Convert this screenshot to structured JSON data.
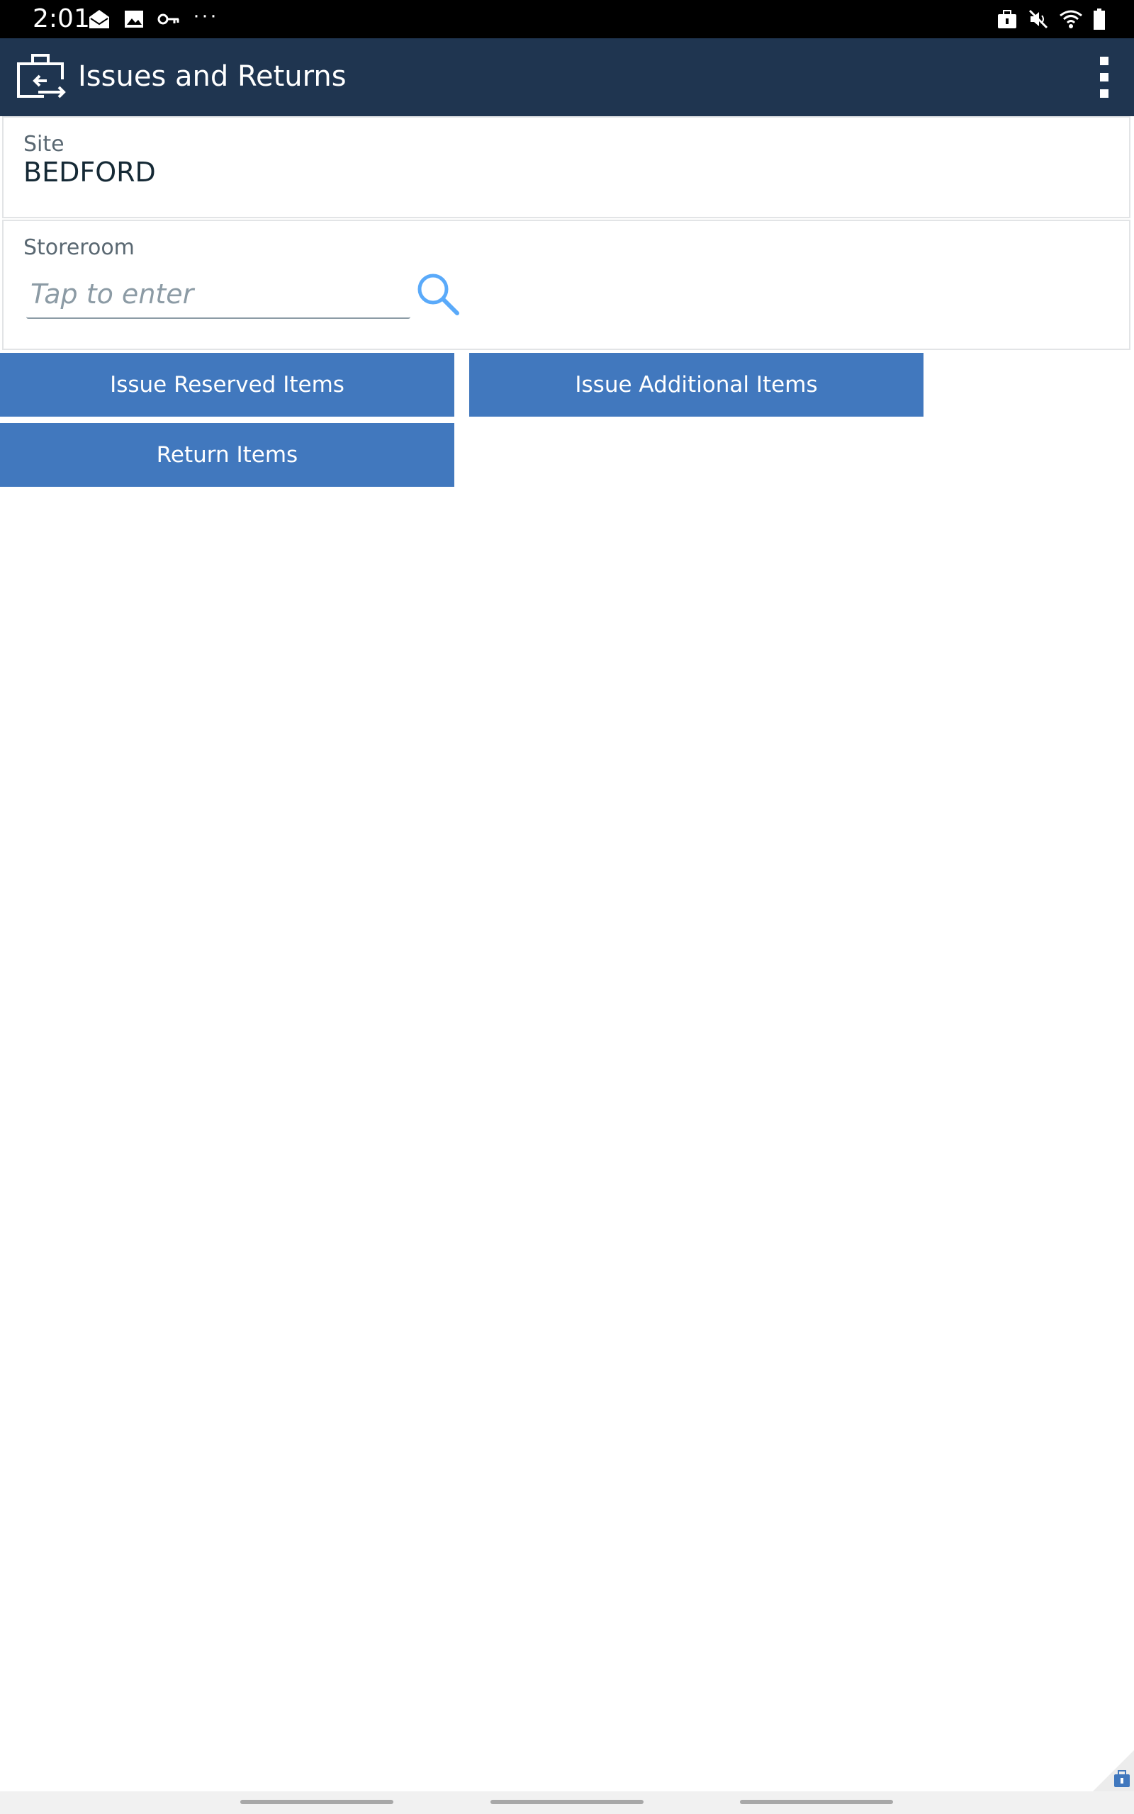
{
  "status_bar": {
    "time": "2:01",
    "left_icons": [
      "mail-open-icon",
      "image-icon",
      "vpn-key-icon",
      "more-notifications-icon"
    ],
    "right_icons": [
      "briefcase-lock-icon",
      "mute-icon",
      "wifi-icon",
      "battery-icon"
    ]
  },
  "header": {
    "title": "Issues and Returns",
    "icon": "issues-returns-icon",
    "menu_icon": "overflow-menu-icon",
    "background": "#1f3550"
  },
  "site": {
    "label": "Site",
    "value": "BEDFORD"
  },
  "storeroom": {
    "label": "Storeroom",
    "value": "",
    "placeholder": "Tap to enter",
    "search_icon": "search-icon"
  },
  "actions": {
    "issue_reserved": "Issue Reserved Items",
    "issue_additional": "Issue Additional Items",
    "return_items": "Return Items",
    "button_color": "#4178be"
  }
}
